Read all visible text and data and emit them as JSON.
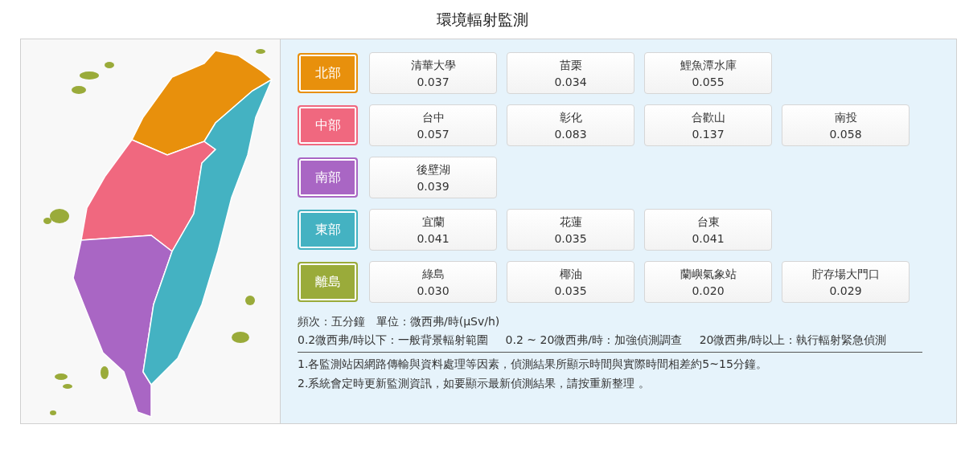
{
  "title": "環境輻射監測",
  "regions": [
    {
      "name": "北部",
      "color": "#e8900c",
      "stations": [
        {
          "name": "清華大學",
          "value": "0.037"
        },
        {
          "name": "苗栗",
          "value": "0.034"
        },
        {
          "name": "鯉魚潭水庫",
          "value": "0.055"
        }
      ]
    },
    {
      "name": "中部",
      "color": "#f0687f",
      "stations": [
        {
          "name": "台中",
          "value": "0.057"
        },
        {
          "name": "彰化",
          "value": "0.083"
        },
        {
          "name": "合歡山",
          "value": "0.137"
        },
        {
          "name": "南投",
          "value": "0.058"
        }
      ]
    },
    {
      "name": "南部",
      "color": "#a966c4",
      "stations": [
        {
          "name": "後壁湖",
          "value": "0.039"
        }
      ]
    },
    {
      "name": "東部",
      "color": "#44b2c2",
      "stations": [
        {
          "name": "宜蘭",
          "value": "0.041"
        },
        {
          "name": "花蓮",
          "value": "0.035"
        },
        {
          "name": "台東",
          "value": "0.041"
        }
      ]
    },
    {
      "name": "離島",
      "color": "#9aab3a",
      "stations": [
        {
          "name": "綠島",
          "value": "0.030"
        },
        {
          "name": "椰油",
          "value": "0.035"
        },
        {
          "name": "蘭嶼氣象站",
          "value": "0.020"
        },
        {
          "name": "貯存場大門口",
          "value": "0.029"
        }
      ]
    }
  ],
  "info": [
    "頻次：五分鐘",
    "單位：微西弗/時(μSv/h)"
  ],
  "legend": [
    "0.2微西弗/時以下 : 一般背景輻射範圍",
    "0.2 ~ 20微西弗/時 : 加強偵測調查",
    "20微西弗/時以上 : 執行輻射緊急偵測"
  ],
  "notes": [
    "1.各監測站因網路傳輸與資料處理等因素，偵測結果所顯示時間與實際時間相差約5~15分鐘。",
    "2.系統會定時更新監測資訊，如要顯示最新偵測結果，請按重新整理 。"
  ]
}
